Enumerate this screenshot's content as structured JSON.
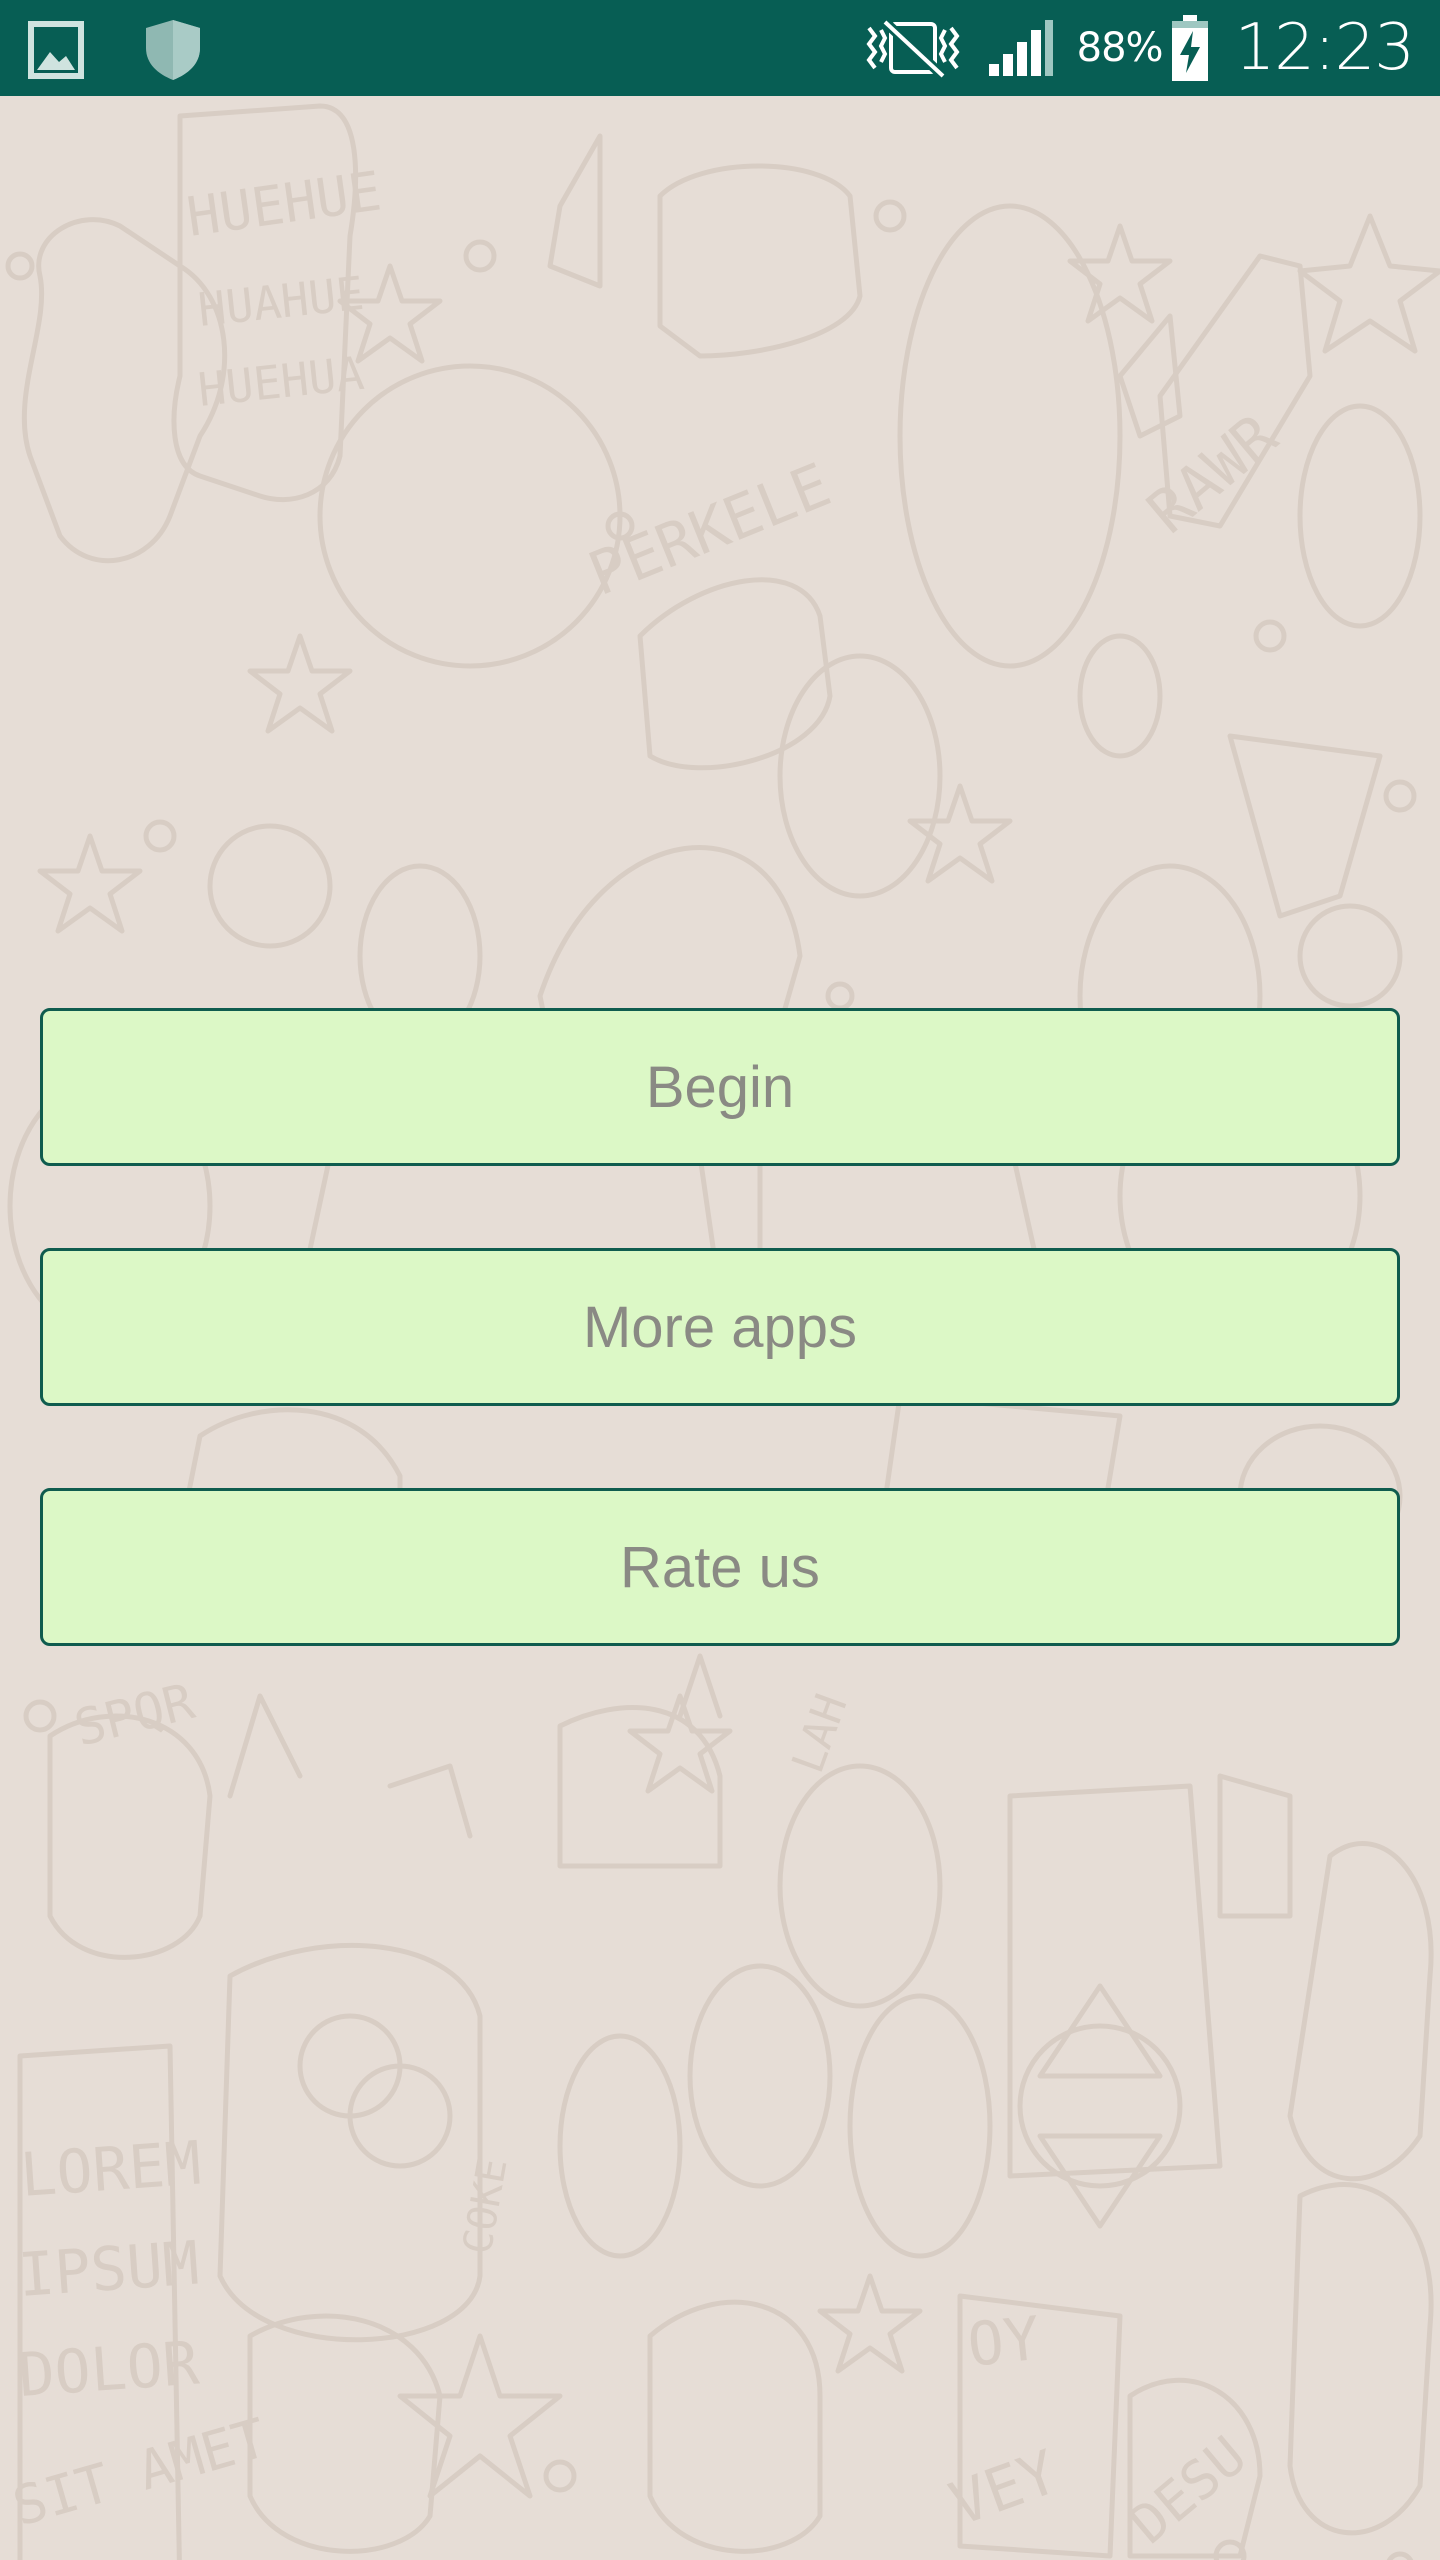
{
  "status_bar": {
    "battery_percent": "88%",
    "time": "12:23",
    "background_color": "#075e54",
    "icons": [
      "gallery-icon",
      "shield-icon",
      "vibrate-mute-icon",
      "signal-icon",
      "battery-charging-icon"
    ]
  },
  "wallpaper": {
    "doodle_texts": [
      "HUEHUE",
      "HUAHUE",
      "HUEHUA",
      "PERKELE",
      "RAWR",
      "SPQR",
      "LAH",
      "COKE",
      "LOREM",
      "IPSUM",
      "DOLOR",
      "SIT AMET",
      "OY",
      "VEY",
      "DESU"
    ]
  },
  "menu": {
    "begin_label": "Begin",
    "more_apps_label": "More apps",
    "rate_us_label": "Rate us",
    "button_color": "#dcf8c6",
    "border_color": "#0f5c4e"
  }
}
